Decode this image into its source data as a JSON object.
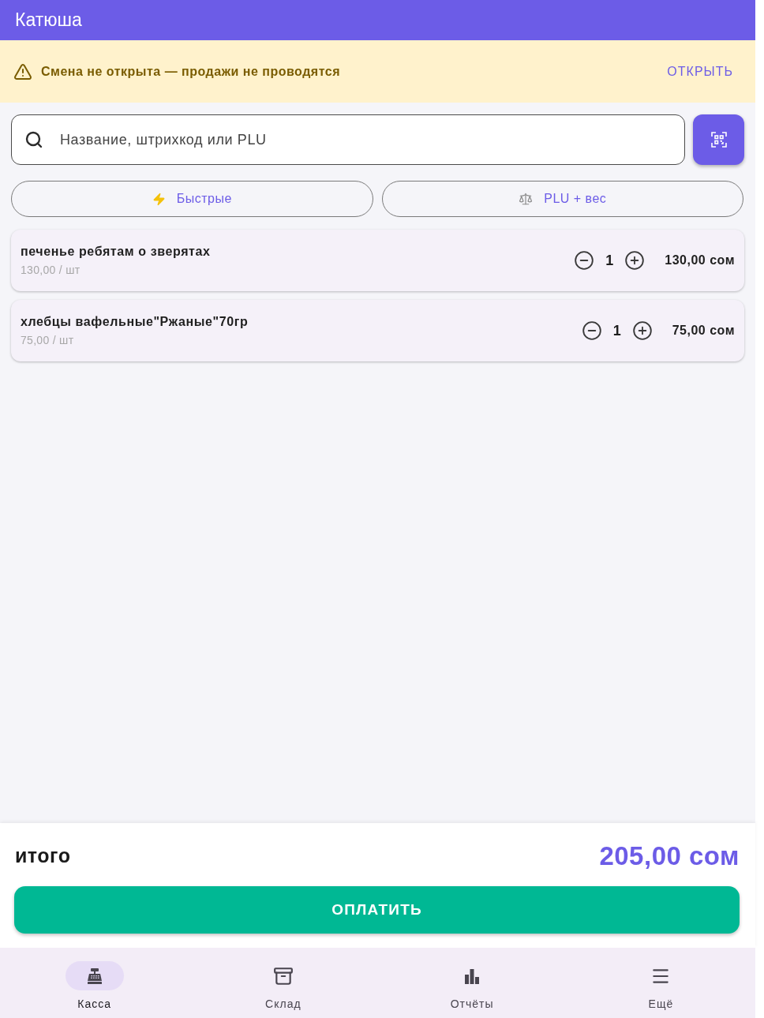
{
  "app_bar": {
    "title": "Катюша"
  },
  "shift_banner": {
    "message": "Смена не открыта — продажи не проводятся",
    "action": "ОТКРЫТЬ"
  },
  "search": {
    "placeholder": "Название, штрихкод или PLU"
  },
  "quick_buttons": [
    {
      "kind": "quick",
      "label": "Быстрые"
    },
    {
      "kind": "weight",
      "label": "PLU + вес"
    }
  ],
  "cart": [
    {
      "name": "печенье ребятам о зверятах",
      "unit_price": "130,00 / шт",
      "quantity": "1",
      "total": "130,00 сом"
    },
    {
      "name": "хлебцы вафельные\"Ржаные\"70гр",
      "unit_price": "75,00 / шт",
      "quantity": "1",
      "total": "75,00 сом"
    }
  ],
  "summary": {
    "label": "итого",
    "total": "205,00 сом"
  },
  "pay_button": {
    "label": "ОПЛАТИТЬ"
  },
  "nav": [
    {
      "kind": "register",
      "label": "Касса",
      "selected": true
    },
    {
      "kind": "warehouse",
      "label": "Склад",
      "selected": false
    },
    {
      "kind": "reports",
      "label": "Отчёты",
      "selected": false
    },
    {
      "kind": "more",
      "label": "Ещё",
      "selected": false
    }
  ]
}
